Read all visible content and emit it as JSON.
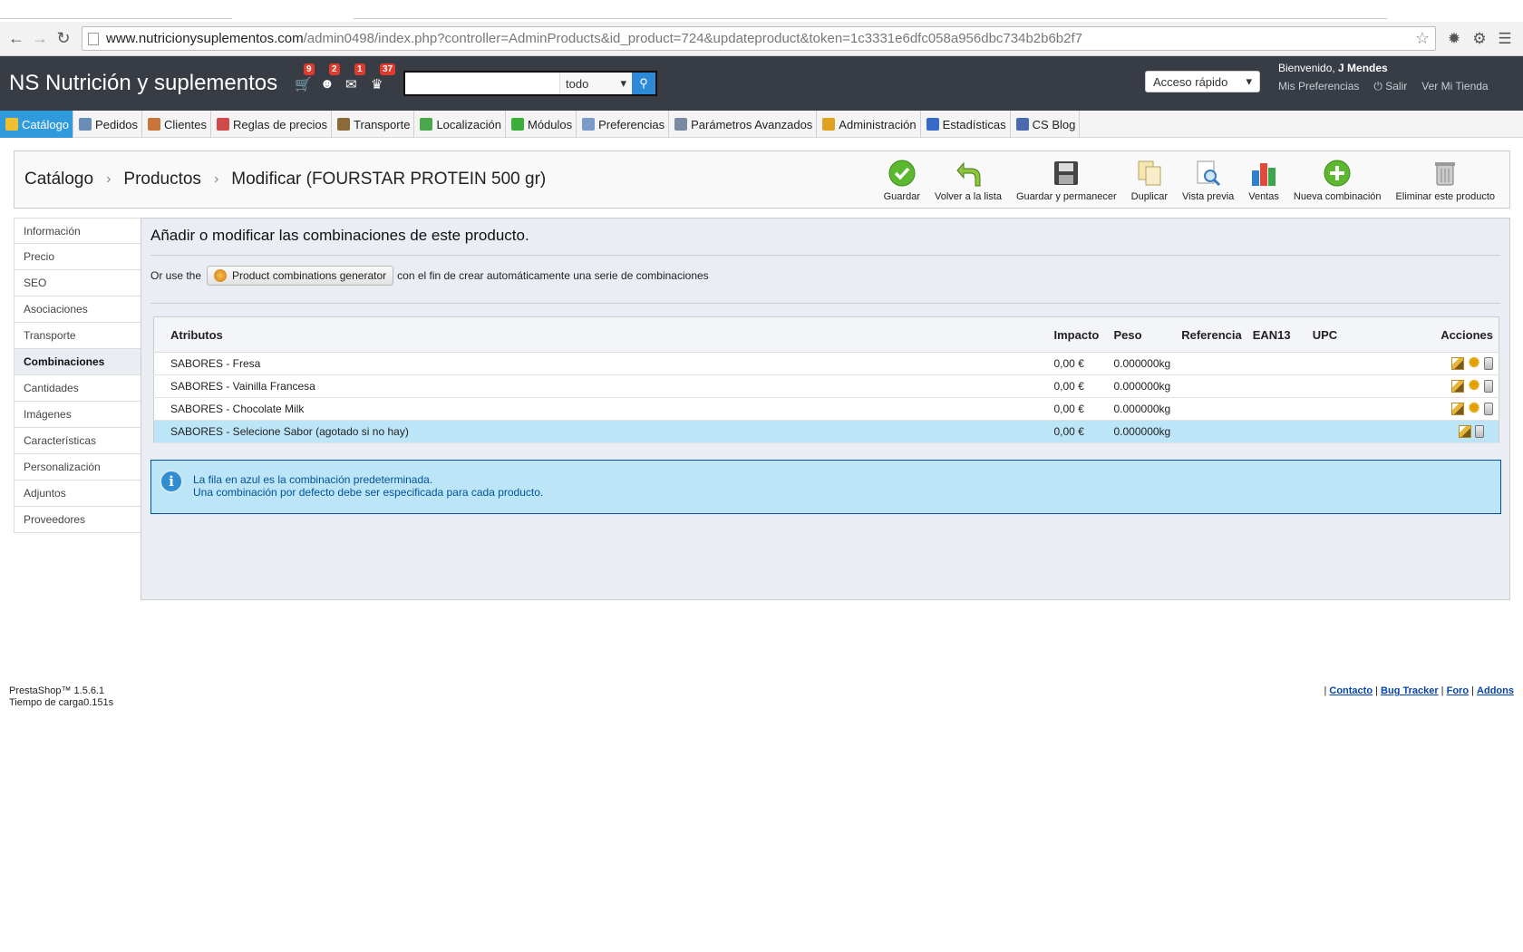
{
  "browser": {
    "url_host": "www.nutricionysuplementos.com",
    "url_path": "/admin0498/index.php?controller=AdminProducts&id_product=724&updateproduct&token=1c3331e6dfc058a956dbc734b2b6b2f7"
  },
  "header": {
    "shop_name": "NS Nutrición y suplementos",
    "notifications": {
      "orders": "9",
      "customers": "2",
      "messages": "1",
      "trophies": "37"
    },
    "search_scope": "todo",
    "quick_access": "Acceso rápido",
    "welcome_prefix": "Bienvenido, ",
    "user_name": "J Mendes",
    "preferences_link": "Mis Preferencias",
    "logout_link": "Salir",
    "view_shop_link": "Ver Mi Tienda"
  },
  "menu": {
    "items": [
      {
        "label": "Catálogo",
        "color": "#f0c030"
      },
      {
        "label": "Pedidos",
        "color": "#6a8db8"
      },
      {
        "label": "Clientes",
        "color": "#c8753a"
      },
      {
        "label": "Reglas de precios",
        "color": "#d04a4a"
      },
      {
        "label": "Transporte",
        "color": "#8a6a3a"
      },
      {
        "label": "Localización",
        "color": "#4aa84a"
      },
      {
        "label": "Módulos",
        "color": "#3ab03a"
      },
      {
        "label": "Preferencias",
        "color": "#7a9ac8"
      },
      {
        "label": "Parámetros Avanzados",
        "color": "#7a8aa0"
      },
      {
        "label": "Administración",
        "color": "#e0a020"
      },
      {
        "label": "Estadísticas",
        "color": "#3a6ac8"
      },
      {
        "label": "CS Blog",
        "color": "#4a6ab0"
      }
    ]
  },
  "titlebar": {
    "crumb1": "Catálogo",
    "crumb2": "Productos",
    "crumb3": "Modificar (FOURSTAR PROTEIN 500 gr)",
    "buttons": {
      "save": "Guardar",
      "back": "Volver a la lista",
      "save_stay": "Guardar y permanecer",
      "duplicate": "Duplicar",
      "preview": "Vista previa",
      "sales": "Ventas",
      "new_combination": "Nueva combinación",
      "delete": "Eliminar este producto"
    }
  },
  "tabs": [
    "Información",
    "Precio",
    "SEO",
    "Asociaciones",
    "Transporte",
    "Combinaciones",
    "Cantidades",
    "Imágenes",
    "Características",
    "Personalización",
    "Adjuntos",
    "Proveedores"
  ],
  "content": {
    "heading": "Añadir o modificar las combinaciones de este producto.",
    "gen_prefix": "Or use the",
    "gen_button": "Product combinations generator",
    "gen_suffix": "con el fin de crear automáticamente una serie de combinaciones",
    "columns": [
      "Atributos",
      "Impacto",
      "Peso",
      "Referencia",
      "EAN13",
      "UPC",
      "Acciones"
    ],
    "rows": [
      {
        "attr": "SABORES - Fresa",
        "impact": "0,00 €",
        "weight": "0.000000kg"
      },
      {
        "attr": "SABORES - Vainilla Francesa",
        "impact": "0,00 €",
        "weight": "0.000000kg"
      },
      {
        "attr": "SABORES - Chocolate Milk",
        "impact": "0,00 €",
        "weight": "0.000000kg"
      },
      {
        "attr": "SABORES - Selecione Sabor (agotado si no hay)",
        "impact": "0,00 €",
        "weight": "0.000000kg"
      }
    ],
    "info_line1": "La fila en azul es la combinación predeterminada.",
    "info_line2": "Una combinación por defecto debe ser especificada para cada producto."
  },
  "footer": {
    "version": "PrestaShop™ 1.5.6.1",
    "load_time": "Tiempo de carga0.151s",
    "links": [
      "Contacto",
      "Bug Tracker",
      "Foro",
      "Addons"
    ]
  }
}
